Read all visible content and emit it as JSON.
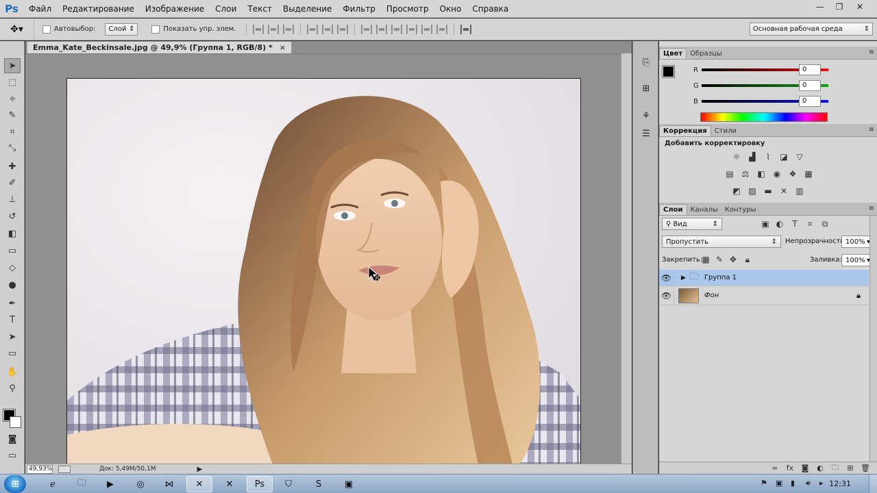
{
  "app": {
    "logo": "Ps"
  },
  "menu": [
    "Файл",
    "Редактирование",
    "Изображение",
    "Слои",
    "Текст",
    "Выделение",
    "Фильтр",
    "Просмотр",
    "Окно",
    "Справка"
  ],
  "window_controls": {
    "minimize": "—",
    "restore": "❐",
    "close": "✕"
  },
  "options": {
    "autoselect_label": "Автовыбор:",
    "autoselect_value": "Слой",
    "show_controls_label": "Показать упр. элем.",
    "workspace": "Основная рабочая среда"
  },
  "document": {
    "tab_title": "Emma_Kate_Beckinsale.jpg @ 49,9% (Группа 1, RGB/8) *",
    "close": "×",
    "zoom": "49,93%",
    "doc_info": "Док: 5,49M/50,1M"
  },
  "color_panel": {
    "tabs": [
      "Цвет",
      "Образцы"
    ],
    "r_label": "R",
    "g_label": "G",
    "b_label": "B",
    "r_value": "0",
    "g_value": "0",
    "b_value": "0",
    "colors": {
      "r": "#e01010",
      "g": "#14a014",
      "b": "#1010d0"
    }
  },
  "adjustments_panel": {
    "tabs": [
      "Коррекция",
      "Стили"
    ],
    "title": "Добавить корректировку"
  },
  "layers_panel": {
    "tabs": [
      "Слои",
      "Каналы",
      "Контуры"
    ],
    "kind_select": "Вид",
    "blend_mode": "Пропустить",
    "opacity_label": "Непрозрачность:",
    "opacity_value": "100%",
    "lock_label": "Закрепить:",
    "fill_label": "Заливка:",
    "fill_value": "100%",
    "layers": [
      {
        "name": "Группа 1",
        "type": "group",
        "visible": true,
        "selected": true
      },
      {
        "name": "Фон",
        "type": "background",
        "visible": true,
        "locked": true
      }
    ]
  },
  "taskbar": {
    "clock": "12:31"
  },
  "icons": {
    "move": "move-tool-icon",
    "marquee": "marquee-icon",
    "lasso": "lasso-icon",
    "quick_select": "quick-select-icon",
    "crop": "crop-icon",
    "eyedropper": "eyedropper-icon",
    "healing": "healing-brush-icon",
    "brush": "brush-icon",
    "stamp": "clone-stamp-icon",
    "history_brush": "history-brush-icon",
    "eraser": "eraser-icon",
    "gradient": "gradient-icon",
    "blur": "blur-icon",
    "dodge": "dodge-icon",
    "pen": "pen-icon",
    "type": "type-icon",
    "path_select": "path-select-icon",
    "shape": "shape-icon",
    "hand": "hand-icon",
    "zoom": "zoom-icon"
  }
}
